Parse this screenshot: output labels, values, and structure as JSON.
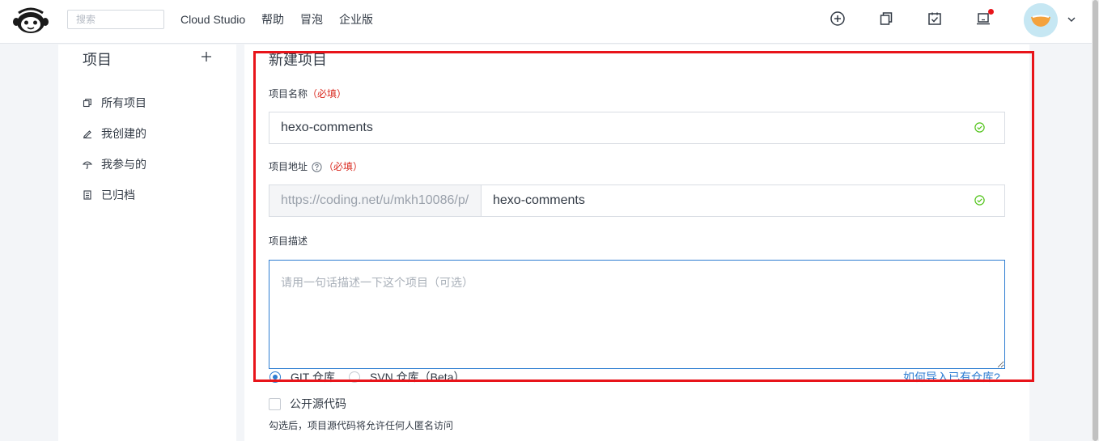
{
  "topnav": {
    "search_placeholder": "搜索",
    "links": [
      "Cloud Studio",
      "帮助",
      "冒泡",
      "企业版"
    ],
    "icons": [
      "plus-circle-icon",
      "copy-icon",
      "calendar-check-icon",
      "laptop-icon"
    ],
    "notification_dot_color": "#e8141a"
  },
  "sidebar": {
    "title": "项目",
    "items": [
      {
        "label": "所有项目",
        "icon": "copy-icon"
      },
      {
        "label": "我创建的",
        "icon": "pencil-icon"
      },
      {
        "label": "我参与的",
        "icon": "umbrella-icon"
      },
      {
        "label": "已归档",
        "icon": "archive-icon"
      }
    ]
  },
  "form": {
    "title": "新建项目",
    "name": {
      "label": "项目名称",
      "required": "（必填）",
      "value": "hexo-comments"
    },
    "address": {
      "label": "项目地址",
      "required": "（必填）",
      "prefix": "https://coding.net/u/mkh10086/p/",
      "value": "hexo-comments"
    },
    "description": {
      "label": "项目描述",
      "placeholder": "请用一句话描述一下这个项目（可选）"
    },
    "repo_types": [
      {
        "label": "GIT 仓库",
        "selected": true
      },
      {
        "label": "SVN 仓库（Beta）",
        "selected": false
      }
    ],
    "import_link": "如何导入已有仓库?",
    "public_source": {
      "label": "公开源代码",
      "checked": false,
      "hint": "勾选后，项目源代码将允许任何人匿名访问"
    }
  },
  "colors": {
    "accent": "#2d7dd2",
    "required": "#d9281e",
    "success": "#52c41a",
    "highlight_border": "#e8141a"
  }
}
